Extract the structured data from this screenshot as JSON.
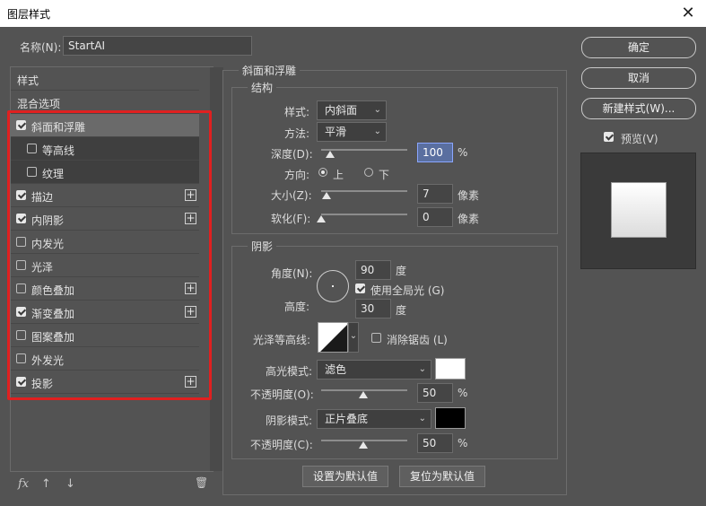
{
  "window": {
    "title": "图层样式",
    "close_glyph": "✕"
  },
  "name_label": "名称(N):",
  "name_value": "StartAI",
  "styles_header": "样式",
  "blend_options": "混合选项",
  "style_items": [
    {
      "label": "斜面和浮雕",
      "checked": true,
      "plus": false
    },
    {
      "label": "等高线",
      "checked": false,
      "plus": false
    },
    {
      "label": "纹理",
      "checked": false,
      "plus": false
    },
    {
      "label": "描边",
      "checked": true,
      "plus": true
    },
    {
      "label": "内阴影",
      "checked": true,
      "plus": true
    },
    {
      "label": "内发光",
      "checked": false,
      "plus": false
    },
    {
      "label": "光泽",
      "checked": false,
      "plus": false
    },
    {
      "label": "颜色叠加",
      "checked": false,
      "plus": true
    },
    {
      "label": "渐变叠加",
      "checked": true,
      "plus": true
    },
    {
      "label": "图案叠加",
      "checked": false,
      "plus": false
    },
    {
      "label": "外发光",
      "checked": false,
      "plus": false
    },
    {
      "label": "投影",
      "checked": true,
      "plus": true
    }
  ],
  "plus_glyph": "+",
  "footer": {
    "fx": "fx",
    "up_icon": "↑",
    "down_icon": "↓",
    "trash_icon": "🗑"
  },
  "bevel": {
    "section_title": "斜面和浮雕",
    "structure_title": "结构",
    "style_label": "样式:",
    "style_value": "内斜面",
    "technique_label": "方法:",
    "technique_value": "平滑",
    "depth_label": "深度(D):",
    "depth_value": "100",
    "depth_unit": "%",
    "direction_label": "方向:",
    "direction_up": "上",
    "direction_down": "下",
    "size_label": "大小(Z):",
    "size_value": "7",
    "size_unit": "像素",
    "soften_label": "软化(F):",
    "soften_value": "0",
    "soften_unit": "像素"
  },
  "shading": {
    "title": "阴影",
    "angle_label": "角度(N):",
    "angle_value": "90",
    "angle_unit": "度",
    "global_light_label": "使用全局光 (G)",
    "altitude_label": "高度:",
    "altitude_value": "30",
    "altitude_unit": "度",
    "gloss_label": "光泽等高线:",
    "anti_alias_label": "消除锯齿 (L)",
    "highlight_mode_label": "高光模式:",
    "highlight_mode_value": "滤色",
    "highlight_color": "#ffffff",
    "highlight_opacity_label": "不透明度(O):",
    "highlight_opacity_value": "50",
    "highlight_opacity_unit": "%",
    "shadow_mode_label": "阴影模式:",
    "shadow_mode_value": "正片叠底",
    "shadow_color": "#000000",
    "shadow_opacity_label": "不透明度(C):",
    "shadow_opacity_value": "50",
    "shadow_opacity_unit": "%"
  },
  "buttons": {
    "set_default": "设置为默认值",
    "reset_default": "复位为默认值",
    "ok": "确定",
    "cancel": "取消",
    "new_style": "新建样式(W)...",
    "preview_label": "预览(V)"
  },
  "colors": {
    "accent_selection": "#e02020",
    "bg": "#535353"
  }
}
